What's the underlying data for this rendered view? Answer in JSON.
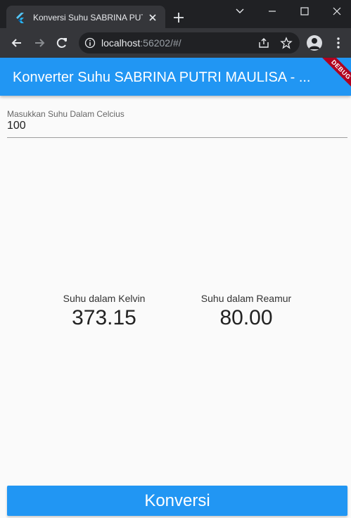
{
  "browser": {
    "tab_title": "Konversi Suhu SABRINA PUTRI MAULISA",
    "url_host": "localhost",
    "url_rest": ":56202/#/"
  },
  "app": {
    "title": "Konverter Suhu SABRINA PUTRI MAULISA - ...",
    "debug_banner": "DEBUG",
    "input": {
      "label": "Masukkan Suhu Dalam Celcius",
      "value": "100"
    },
    "results": {
      "kelvin": {
        "label": "Suhu dalam Kelvin",
        "value": "373.15"
      },
      "reamur": {
        "label": "Suhu dalam Reamur",
        "value": "80.00"
      }
    },
    "button_label": "Konversi"
  },
  "colors": {
    "primary": "#2196f3",
    "browser_frame": "#202124",
    "browser_toolbar": "#35363a",
    "debug_banner": "#b0001f"
  },
  "icons": [
    "flutter-favicon",
    "close-icon",
    "plus-icon",
    "chevron-down-icon",
    "minimize-icon",
    "maximize-icon",
    "window-close-icon",
    "back-arrow-icon",
    "forward-arrow-icon",
    "reload-icon",
    "info-icon",
    "share-icon",
    "star-icon",
    "profile-icon",
    "kebab-menu-icon"
  ]
}
